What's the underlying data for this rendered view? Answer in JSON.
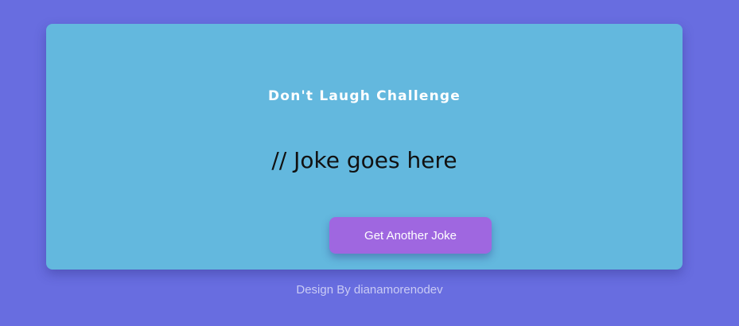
{
  "card": {
    "title": "Don't Laugh Challenge",
    "joke_text": "// Joke goes here",
    "button_label": "Get Another Joke"
  },
  "footer": {
    "credit": "Design By dianamorenodev"
  },
  "colors": {
    "background": "#686de0",
    "card": "#63b8de",
    "button": "#9f67e0",
    "title_text": "#ffffff",
    "footer_text": "#c9cbf4"
  }
}
